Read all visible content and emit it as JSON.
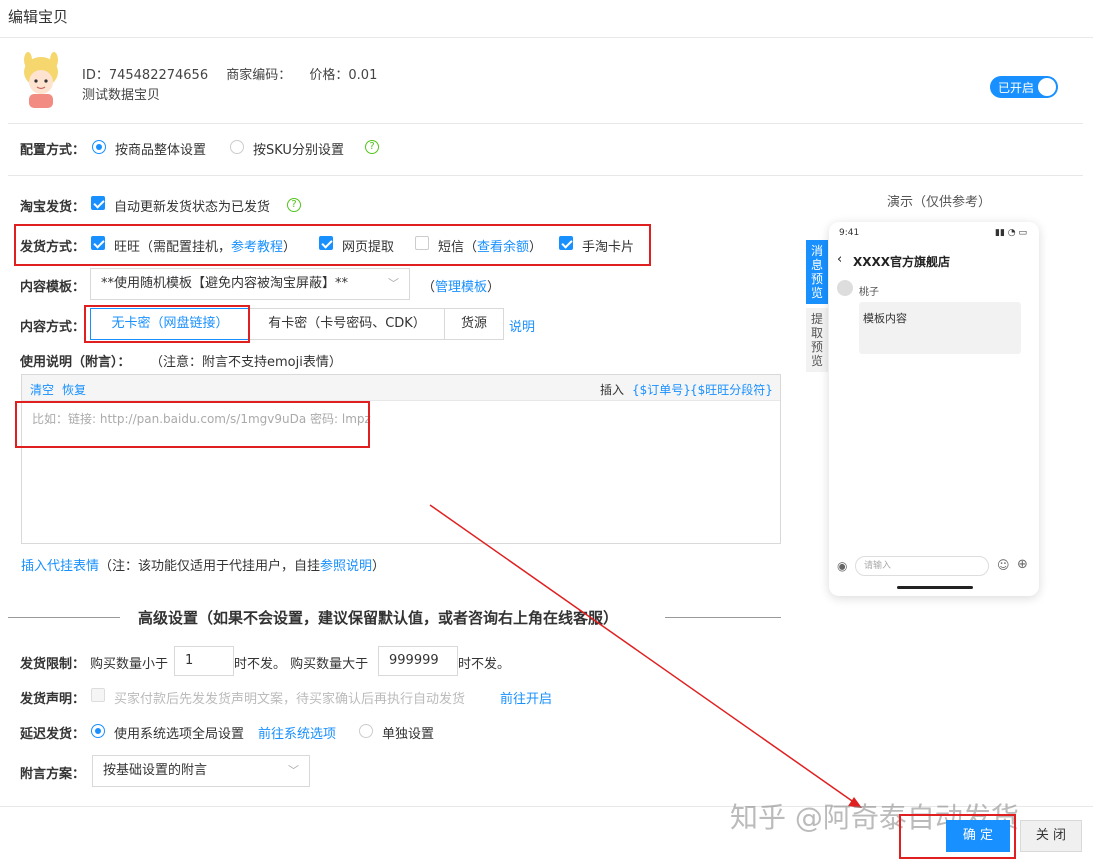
{
  "header": {
    "title": "编辑宝贝"
  },
  "product": {
    "id_text": "ID：745482274656",
    "merchant_code_label": "商家编码：",
    "price_label": "价格：0.01",
    "name": "测试数据宝贝",
    "toggle_label": "已开启"
  },
  "config": {
    "label": "配置方式：",
    "option_whole": "按商品整体设置",
    "option_sku": "按SKU分别设置"
  },
  "taobao": {
    "label": "淘宝发货：",
    "auto_update": "自动更新发货状态为已发货"
  },
  "delivery": {
    "label": "发货方式：",
    "wangwang": "旺旺（需配置挂机，",
    "wangwang_link": "参考教程",
    "wangwang_end": "）",
    "web": "网页提取",
    "sms": "短信（",
    "sms_link": "查看余额",
    "sms_end": "）",
    "card": "手淘卡片"
  },
  "template": {
    "label": "内容模板：",
    "value": "**使用随机模板【避免内容被淘宝屏蔽】**",
    "manage_open": "（",
    "manage_link": "管理模板",
    "manage_close": "）"
  },
  "content_mode": {
    "label": "内容方式：",
    "seg1": "无卡密（网盘链接）",
    "seg2": "有卡密（卡号密码、CDK）",
    "seg3": "货源",
    "help_link": "说明"
  },
  "instructions": {
    "label": "使用说明（附言）：",
    "note": "（注意：附言不支持emoji表情）",
    "clear": "清空",
    "restore": "恢复",
    "insert": "插入",
    "order_var": "{$订单号}",
    "ww_var": "{$旺旺分段符}",
    "placeholder": "比如：链接: http://pan.baidu.com/s/1mgv9uDa 密码: lmpz"
  },
  "emoji": {
    "link": "插入代挂表情",
    "note": "（注：该功能仅适用于代挂用户，自挂",
    "ref_link": "参照说明",
    "end": "）"
  },
  "advanced": {
    "title": "高级设置（如果不会设置，建议保留默认值，或者咨询右上角在线客服）"
  },
  "limit": {
    "label": "发货限制：",
    "pre1": "购买数量小于",
    "min": "1",
    "mid": "时不发。 购买数量大于",
    "max": "999999",
    "post": "时不发。"
  },
  "declare": {
    "label": "发货声明：",
    "text": "买家付款后先发发货声明文案，待买家确认后再执行自动发货",
    "link": "前往开启"
  },
  "delay": {
    "label": "延迟发货：",
    "opt1": "使用系统选项全局设置",
    "opt1_link": "前往系统选项",
    "opt2": "单独设置"
  },
  "postscript": {
    "label": "附言方案：",
    "value": "按基础设置的附言"
  },
  "preview": {
    "title": "演示（仅供参考）",
    "tab_msg": "消息预览",
    "tab_extract": "提取预览",
    "time": "9:41",
    "shop": "XXXX官方旗舰店",
    "user": "桃子",
    "bubble": "模板内容",
    "input_placeholder": "请输入"
  },
  "footer": {
    "ok": "确 定",
    "close": "关 闭",
    "watermark": "知乎 @阿奇泰自动发货"
  },
  "colors": {
    "accent": "#1890ff",
    "highlight": "#e02020"
  }
}
